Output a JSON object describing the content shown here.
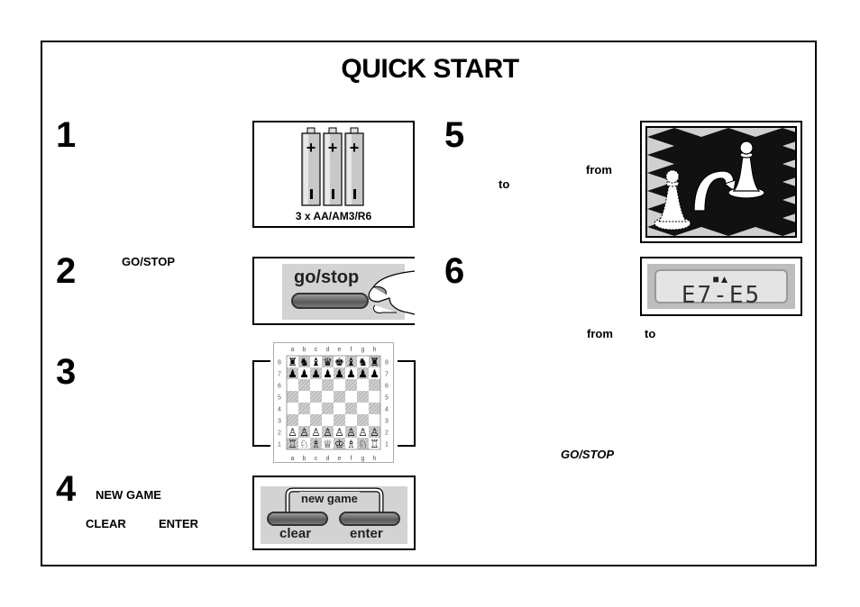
{
  "title": "QUICK START",
  "steps": [
    {
      "number": "1",
      "labels": [],
      "figure": {
        "type": "batteries",
        "caption": "3 x AA/AM3/R6",
        "battery_count": 3,
        "positive_symbol": "+",
        "negative_symbol": "I"
      }
    },
    {
      "number": "2",
      "labels": [
        "GO/STOP"
      ],
      "figure": {
        "type": "button-press",
        "button_label": "go/stop"
      }
    },
    {
      "number": "3",
      "labels": [],
      "figure": {
        "type": "chessboard",
        "files": [
          "a",
          "b",
          "c",
          "d",
          "e",
          "f",
          "g",
          "h"
        ],
        "ranks": [
          "8",
          "7",
          "6",
          "5",
          "4",
          "3",
          "2",
          "1"
        ],
        "rows": [
          [
            "♜",
            "♞",
            "♝",
            "♛",
            "♚",
            "♝",
            "♞",
            "♜"
          ],
          [
            "♟",
            "♟",
            "♟",
            "♟",
            "♟",
            "♟",
            "♟",
            "♟"
          ],
          [
            "",
            "",
            "",
            "",
            "",
            "",
            "",
            ""
          ],
          [
            "",
            "",
            "",
            "",
            "",
            "",
            "",
            ""
          ],
          [
            "",
            "",
            "",
            "",
            "",
            "",
            "",
            ""
          ],
          [
            "",
            "",
            "",
            "",
            "",
            "",
            "",
            ""
          ],
          [
            "♙",
            "♙",
            "♙",
            "♙",
            "♙",
            "♙",
            "♙",
            "♙"
          ],
          [
            "♖",
            "♘",
            "♗",
            "♕",
            "♔",
            "♗",
            "♘",
            "♖"
          ]
        ]
      }
    },
    {
      "number": "4",
      "labels": [
        "NEW GAME",
        "CLEAR",
        "ENTER"
      ],
      "figure": {
        "type": "button-combo",
        "combo_label": "new game",
        "left_button": "clear",
        "right_button": "enter"
      }
    },
    {
      "number": "5",
      "labels": [
        "from",
        "to"
      ],
      "figure": {
        "type": "pawn-move"
      }
    },
    {
      "number": "6",
      "labels": [
        "from",
        "to",
        "GO/STOP"
      ],
      "figure": {
        "type": "lcd",
        "icons": "■▲",
        "display": "E7-E5"
      }
    }
  ]
}
